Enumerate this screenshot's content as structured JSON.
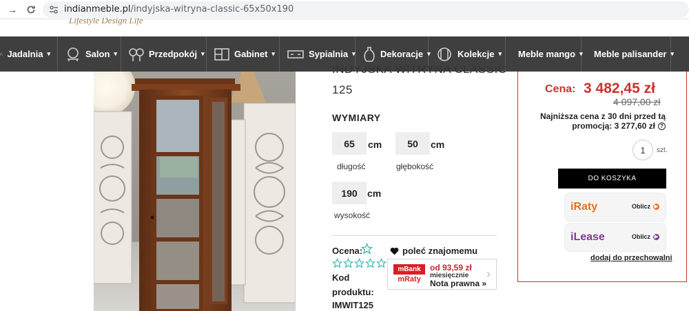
{
  "browser": {
    "url_domain": "indianmeble.pl",
    "url_path": "/indyjska-witryna-classic-65x50x190"
  },
  "logo": {
    "tagline": "Lifestyle Design Life"
  },
  "nav": {
    "items": [
      {
        "label": "Jadalnia",
        "icon": "chair-icon"
      },
      {
        "label": "Salon",
        "icon": "armchair-icon"
      },
      {
        "label": "Przedpokój",
        "icon": "mirror-icon"
      },
      {
        "label": "Gabinet",
        "icon": "cabinet-icon"
      },
      {
        "label": "Sypialnia",
        "icon": "bed-icon"
      },
      {
        "label": "Dekoracje",
        "icon": "vase-icon"
      },
      {
        "label": "Kolekcje",
        "icon": "collection-icon"
      },
      {
        "label": "Meble mango",
        "icon": ""
      },
      {
        "label": "Meble palisander",
        "icon": ""
      }
    ]
  },
  "product": {
    "title_line1": "INDYJSKA WITRYNA CLASSIC",
    "title_line2": "125",
    "dimensions_heading": "WYMIARY",
    "length": {
      "value": "65",
      "unit": "cm",
      "label": "długość"
    },
    "depth": {
      "value": "50",
      "unit": "cm",
      "label": "głębokość"
    },
    "height": {
      "value": "190",
      "unit": "cm",
      "label": "wysokość"
    },
    "rating_label": "Ocena:",
    "rating_value": 0,
    "rating_max": 5,
    "recommend_label": "poleć znajomemu",
    "code_label": "Kod produktu:",
    "code_value": "IMWIT125"
  },
  "mbank": {
    "logo_top": "mBank",
    "logo_bottom": "mRaty",
    "amount": "od 93,59 zł",
    "monthly": "miesięcznie",
    "note": "Nota prawna »"
  },
  "purchase": {
    "price_label": "Cena:",
    "price": "3 482,45 zł",
    "old_price": "4 097,00 zł",
    "lowest_line1": "Najniższa cena z 30 dni przed tą",
    "lowest_line2": "promocją: 3 277,60 zł",
    "quantity": "1",
    "quantity_unit": "szt.",
    "cart_button": "DO KOSZYKA",
    "iraty_name": "iRaty",
    "iraty_calc": "Oblicz",
    "ilease_name": "iLease",
    "ilease_calc": "Oblicz",
    "storage_link": "dodaj do przechowalni"
  },
  "colors": {
    "nav_bg": "#3f3f3f",
    "accent_red": "#c9332d",
    "iraty_orange": "#e8711f",
    "ilease_purple": "#7d3c8f",
    "mbank_red": "#c0272d"
  }
}
